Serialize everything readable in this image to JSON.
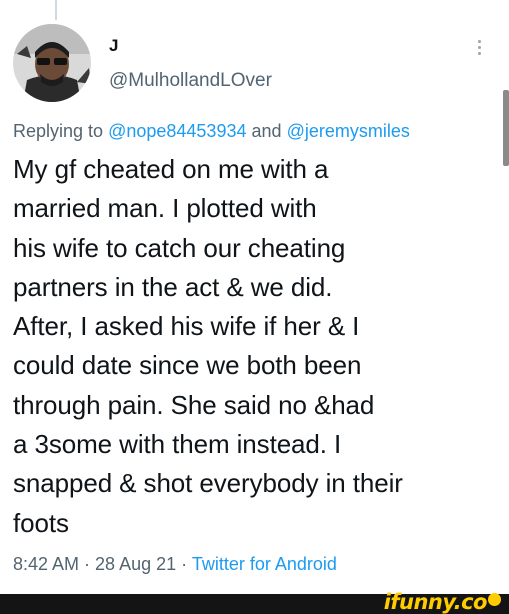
{
  "author": {
    "display_name": "J",
    "handle": "@MulhollandLOver"
  },
  "reply": {
    "prefix": "Replying to",
    "mention_1": "@nope84453934",
    "conjunction": "and",
    "mention_2": "@jeremysmiles"
  },
  "tweet": {
    "lines": [
      "My gf cheated on me with a",
      "married man. I plotted with",
      "his wife to catch our cheating",
      "partners in the act & we did.",
      "After, I asked his wife if her & I",
      "could date since we both been",
      "through pain. She said no &had",
      "a 3some with them instead. I",
      "snapped & shot everybody in their",
      "foots"
    ]
  },
  "meta": {
    "time": "8:42 AM",
    "separator_1": " · ",
    "date": "28 Aug 21",
    "separator_2": " · ",
    "source": "Twitter for Android"
  },
  "watermark": {
    "text": "ifunny.co"
  },
  "icons": {
    "more": "more-vertical-icon",
    "avatar": "avatar"
  },
  "colors": {
    "link": "#1d9bf0",
    "secondary_text": "#536471",
    "text": "#0f1419",
    "watermark_bar": "#141414",
    "watermark_text": "#ffcc00"
  }
}
